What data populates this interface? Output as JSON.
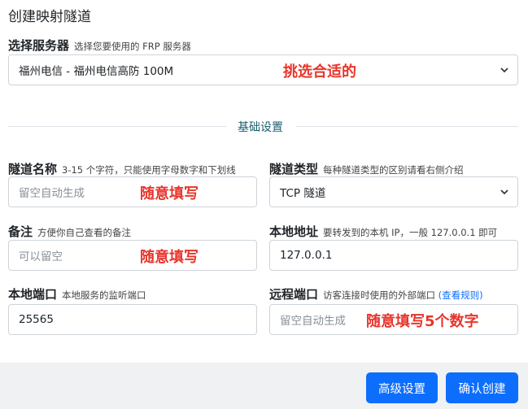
{
  "dialog": {
    "title": "创建映射隧道"
  },
  "server": {
    "label": "选择服务器",
    "hint": "选择您要使用的 FRP 服务器",
    "selected": "福州电信 - 福州电信高防 100M",
    "annotation": "挑选合适的"
  },
  "section": {
    "title": "基础设置"
  },
  "tunnel_name": {
    "label": "隧道名称",
    "hint": "3-15 个字符，只能使用字母数字和下划线",
    "placeholder": "留空自动生成",
    "annotation": "随意填写"
  },
  "tunnel_type": {
    "label": "隧道类型",
    "hint": "每种隧道类型的区别请看右侧介绍",
    "selected": "TCP 隧道"
  },
  "remark": {
    "label": "备注",
    "hint": "方便你自己查看的备注",
    "placeholder": "可以留空",
    "annotation": "随意填写"
  },
  "local_addr": {
    "label": "本地地址",
    "hint": "要转发到的本机 IP，一般 127.0.0.1 即可",
    "value": "127.0.0.1"
  },
  "local_port": {
    "label": "本地端口",
    "hint": "本地服务的监听端口",
    "value": "25565"
  },
  "remote_port": {
    "label": "远程端口",
    "hint": "访客连接时使用的外部端口",
    "link": "(查看规则)",
    "placeholder": "留空自动生成",
    "annotation": "随意填写5个数字"
  },
  "footer": {
    "advanced_label": "高级设置",
    "confirm_label": "确认创建"
  }
}
